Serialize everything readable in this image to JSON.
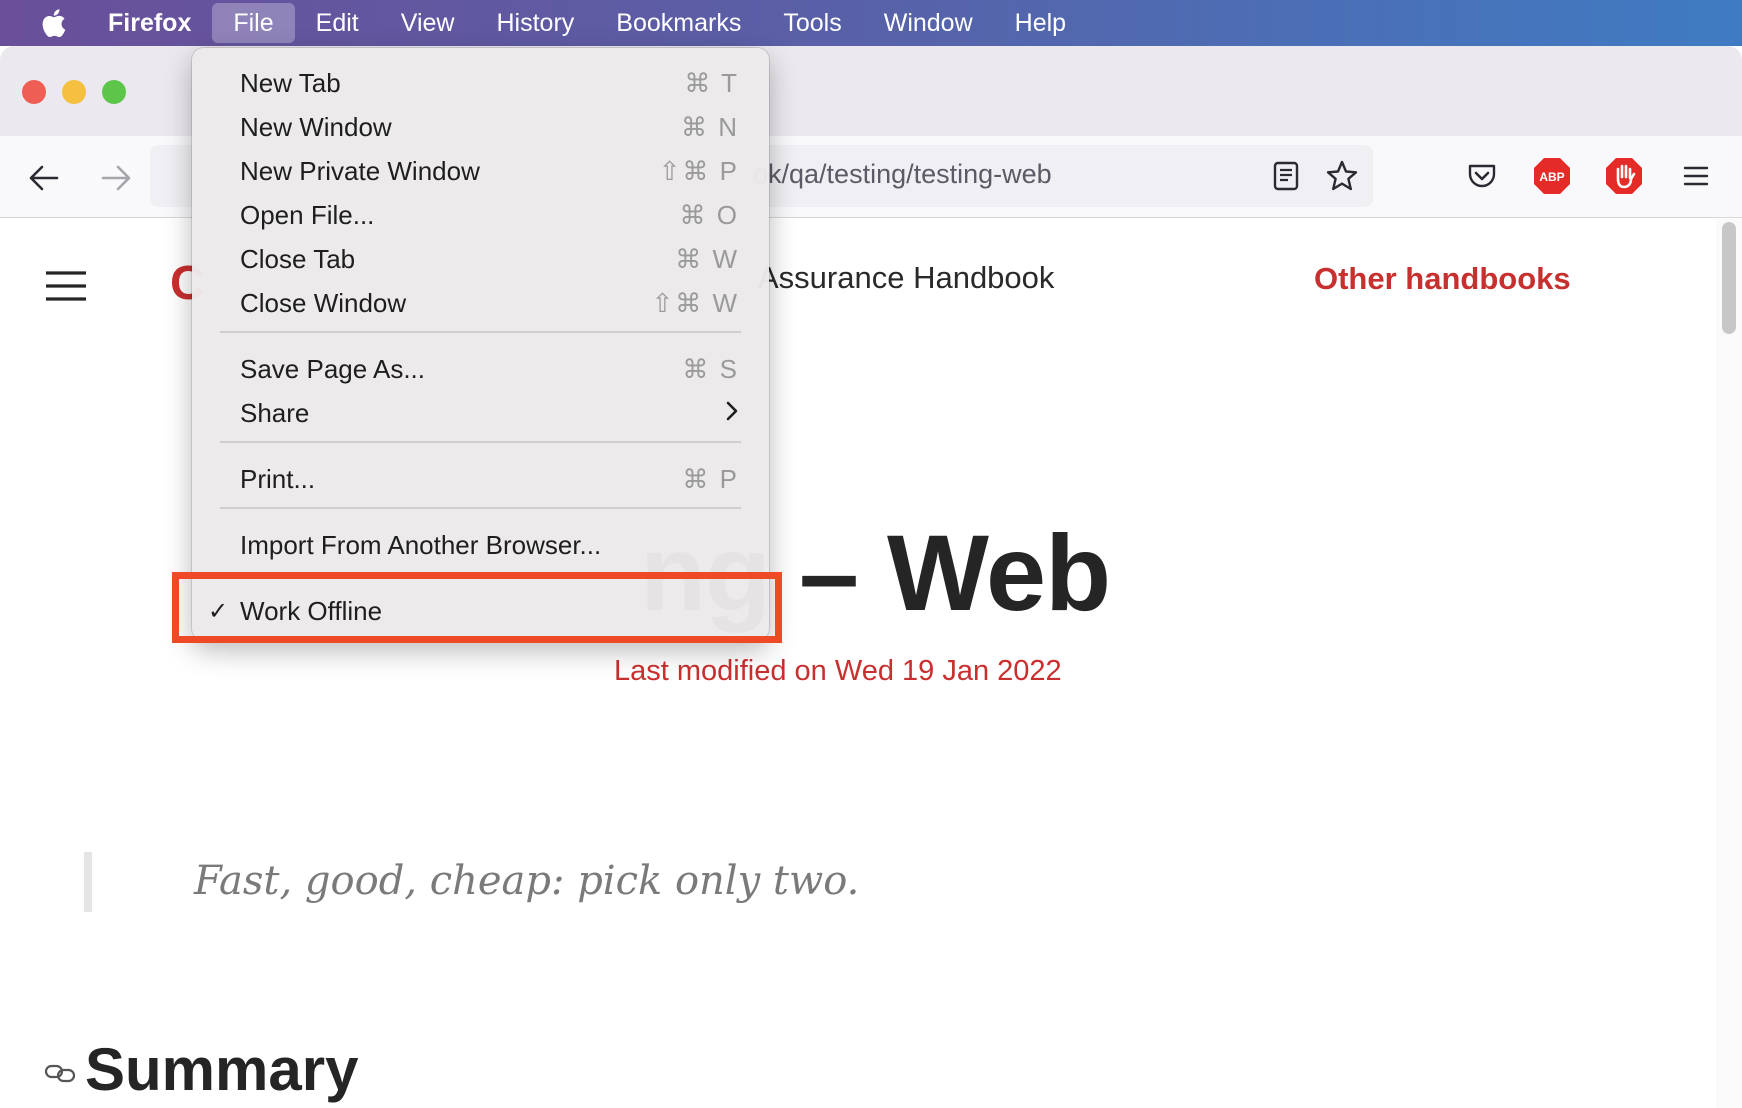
{
  "menubar": {
    "app": "Firefox",
    "items": [
      "File",
      "Edit",
      "View",
      "History",
      "Bookmarks",
      "Tools",
      "Window",
      "Help"
    ],
    "active": "File"
  },
  "toolbar": {
    "url": "ok/qa/testing/testing-web"
  },
  "file_menu": {
    "items": [
      {
        "label": "New Tab",
        "shortcut": "⌘ T"
      },
      {
        "label": "New Window",
        "shortcut": "⌘ N"
      },
      {
        "label": "New Private Window",
        "shortcut": "⇧⌘ P"
      },
      {
        "label": "Open File...",
        "shortcut": "⌘ O"
      },
      {
        "label": "Close Tab",
        "shortcut": "⌘ W"
      },
      {
        "label": "Close Window",
        "shortcut": "⇧⌘ W"
      },
      {
        "label": "Save Page As...",
        "shortcut": "⌘ S"
      },
      {
        "label": "Share",
        "shortcut": ""
      },
      {
        "label": "Print...",
        "shortcut": "⌘ P"
      },
      {
        "label": "Import From Another Browser...",
        "shortcut": ""
      },
      {
        "label": "Work Offline",
        "shortcut": "",
        "checked": true
      }
    ],
    "check_mark": "✓"
  },
  "page": {
    "logo_letter": "C",
    "handbook_title": "Assurance Handbook",
    "other_handbooks": "Other handbooks",
    "title_visible": "ng – Web",
    "last_modified": "Last modified on Wed 19 Jan 2022",
    "quote": "Fast, good, cheap: pick only two.",
    "summary_heading": "Summary"
  },
  "colors": {
    "accent": "#c8302f",
    "highlight": "#ee4a27"
  }
}
